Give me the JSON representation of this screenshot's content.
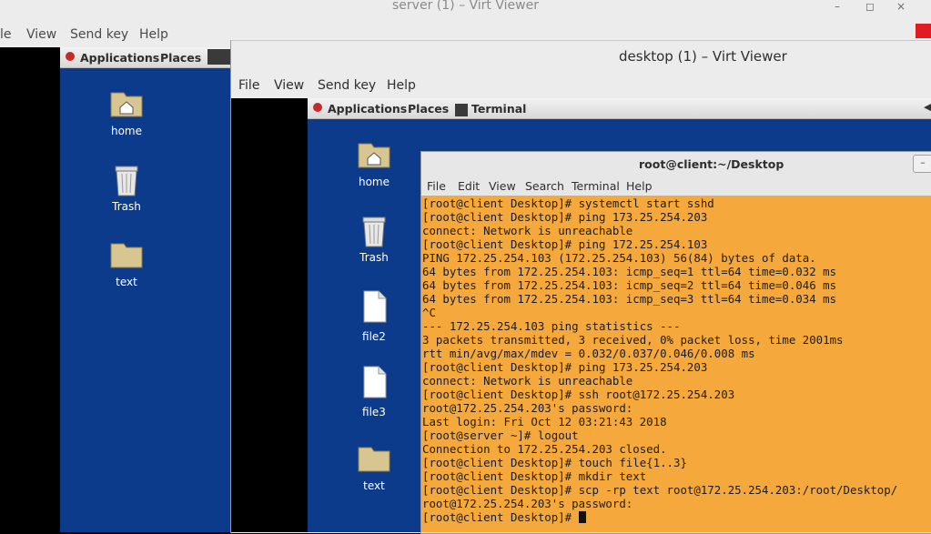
{
  "outer_window": {
    "title": "server (1) – Virt Viewer",
    "controls": {
      "minimize": "–",
      "maximize": "◻",
      "close": "×"
    },
    "menu": [
      "le",
      "View",
      "Send key",
      "Help"
    ]
  },
  "outer_guest": {
    "panel": {
      "applications": "Applications",
      "places": "Places"
    },
    "icons": [
      {
        "label": "home",
        "icon": "home-folder-icon"
      },
      {
        "label": "Trash",
        "icon": "trash-icon"
      },
      {
        "label": "text",
        "icon": "folder-icon"
      }
    ]
  },
  "inner_window": {
    "title": "desktop (1) – Virt Viewer",
    "menu": [
      "File",
      "View",
      "Send key",
      "Help"
    ]
  },
  "inner_guest": {
    "panel": {
      "applications": "Applications",
      "places": "Places",
      "task": "Terminal"
    },
    "icons": [
      {
        "label": "home",
        "icon": "home-folder-icon"
      },
      {
        "label": "Trash",
        "icon": "trash-icon"
      },
      {
        "label": "file2",
        "icon": "file-icon"
      },
      {
        "label": "file3",
        "icon": "file-icon"
      },
      {
        "label": "text",
        "icon": "folder-icon"
      }
    ]
  },
  "terminal": {
    "title": "root@client:~/Desktop",
    "menu": [
      "File",
      "Edit",
      "View",
      "Search",
      "Terminal",
      "Help"
    ],
    "lines": [
      "[root@client Desktop]# systemctl start sshd",
      "[root@client Desktop]# ping 173.25.254.203",
      "connect: Network is unreachable",
      "[root@client Desktop]# ping 172.25.254.103",
      "PING 172.25.254.103 (172.25.254.103) 56(84) bytes of data.",
      "64 bytes from 172.25.254.103: icmp_seq=1 ttl=64 time=0.032 ms",
      "64 bytes from 172.25.254.103: icmp_seq=2 ttl=64 time=0.046 ms",
      "64 bytes from 172.25.254.103: icmp_seq=3 ttl=64 time=0.034 ms",
      "^C",
      "--- 172.25.254.103 ping statistics ---",
      "3 packets transmitted, 3 received, 0% packet loss, time 2001ms",
      "rtt min/avg/max/mdev = 0.032/0.037/0.046/0.008 ms",
      "[root@client Desktop]# ping 173.25.254.203",
      "connect: Network is unreachable",
      "[root@client Desktop]# ssh root@172.25.254.203",
      "root@172.25.254.203's password:",
      "Last login: Fri Oct 12 03:21:43 2018",
      "[root@server ~]# logout",
      "Connection to 172.25.254.203 closed.",
      "[root@client Desktop]# touch file{1..3}",
      "[root@client Desktop]# mkdir text",
      "[root@client Desktop]# scp -rp text root@172.25.254.203:/root/Desktop/",
      "root@172.25.254.203's password:"
    ],
    "prompt": "[root@client Desktop]# "
  },
  "colors": {
    "desktop_blue": "#0d3b8c",
    "terminal_bg": "#f5a83b"
  }
}
